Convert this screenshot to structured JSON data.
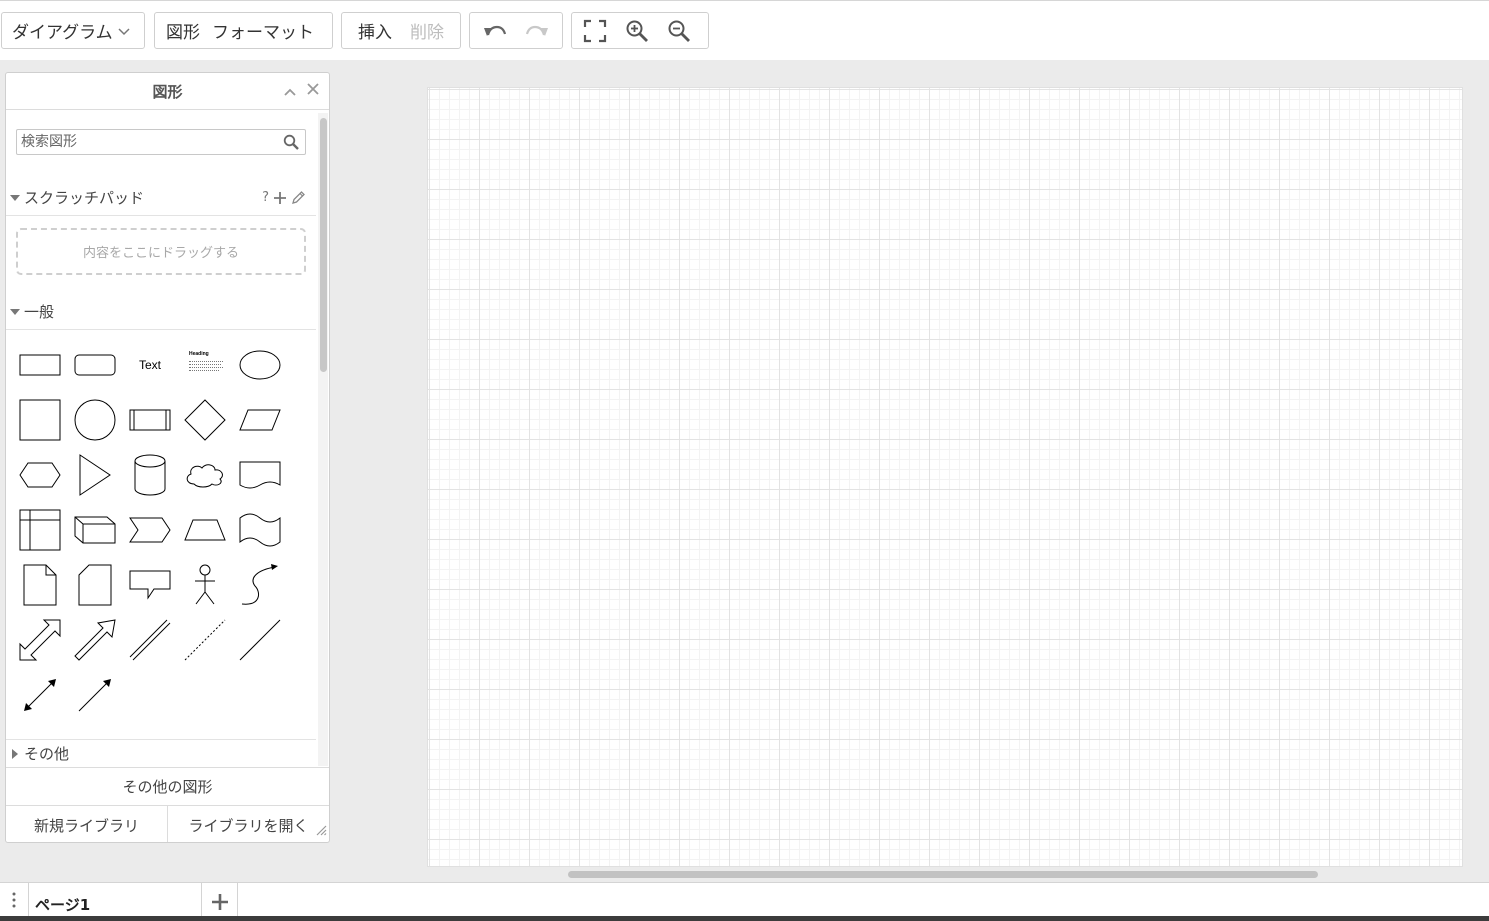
{
  "toolbar": {
    "diagram_menu": "ダイアグラム",
    "shape_label": "図形",
    "format_label": "フォーマット",
    "insert_label": "挿入",
    "delete_label": "削除"
  },
  "panel": {
    "title": "図形",
    "search_placeholder": "検索図形",
    "scratchpad": {
      "label": "スクラッチパッド",
      "help": "?",
      "drop_hint": "内容をここにドラッグする"
    },
    "general": {
      "label": "一般",
      "text_shape": "Text",
      "heading_shape": "Heading"
    },
    "other": {
      "label": "その他"
    },
    "more_shapes": "その他の図形",
    "new_library": "新規ライブラリ",
    "open_library": "ライブラリを開く"
  },
  "pages": {
    "tabs": [
      {
        "label": "ページ1"
      }
    ]
  },
  "colors": {
    "canvas_background": "#ffffff",
    "grid_major": "#e3e3e3",
    "grid_minor": "#f3f3f3",
    "app_background": "#ebebeb"
  }
}
